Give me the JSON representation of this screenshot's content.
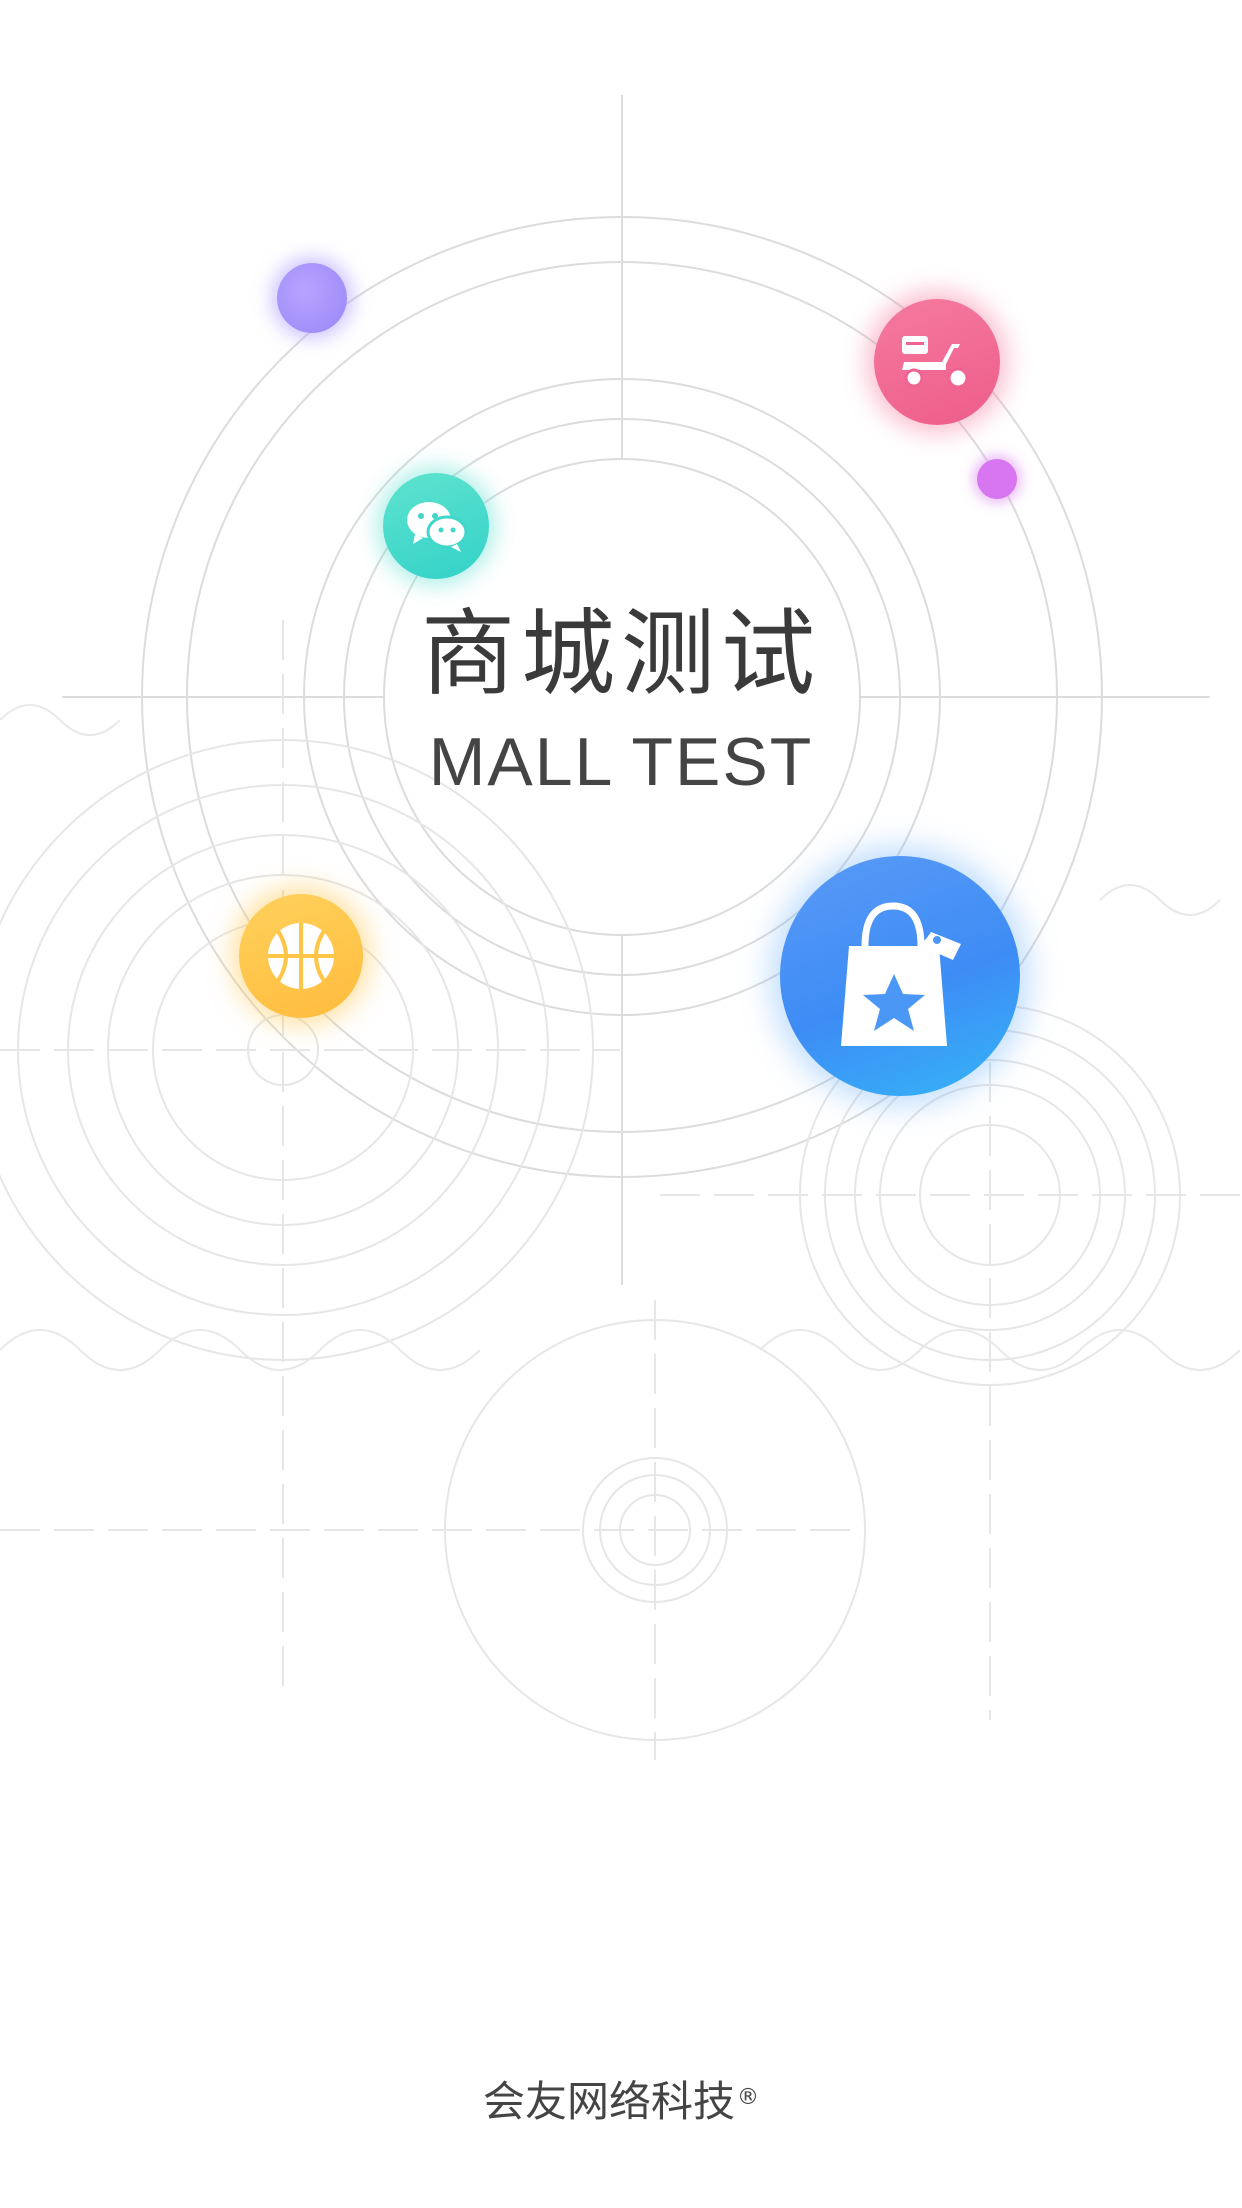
{
  "splash": {
    "title_cn": "商城测试",
    "title_en": "MALL TEST"
  },
  "icons": {
    "dot_left": "purple-dot",
    "dot_right": "magenta-dot",
    "wechat": "wechat-icon",
    "delivery": "delivery-scooter-icon",
    "basketball": "basketball-icon",
    "shop": "shopping-bag-star-icon"
  },
  "colors": {
    "wechat": "#3fd8cb",
    "delivery": "#f06490",
    "basketball": "#ffc547",
    "shop": "#4a97f6",
    "purple": "#a592fa",
    "magenta": "#d776f0"
  },
  "footer": {
    "company": "会友网络科技",
    "registered_mark": "®"
  }
}
